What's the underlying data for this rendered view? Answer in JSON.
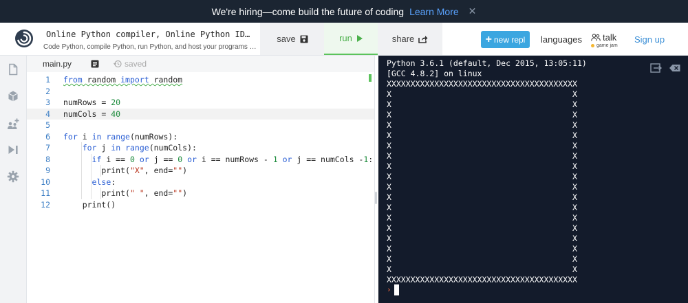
{
  "banner": {
    "text": "We're hiring—come build the future of coding",
    "link": "Learn More",
    "close": "✕"
  },
  "header": {
    "title": "Online Python compiler, Online Python ID…",
    "subtitle": "Code Python, compile Python, run Python, and host your programs …",
    "save_label": "save",
    "run_label": "run",
    "share_label": "share",
    "new_repl_label": "new repl",
    "languages_label": "languages",
    "talk_label": "talk",
    "talk_sub": "game jam",
    "signup_label": "Sign up"
  },
  "editor": {
    "tab": "main.py",
    "saved_label": "saved",
    "lines": [
      {
        "n": "1",
        "html": "<span class=\"squig\"><span class=\"kw\">from</span> random <span class=\"kw\">import</span> random</span>"
      },
      {
        "n": "2",
        "html": ""
      },
      {
        "n": "3",
        "html": "numRows = <span class=\"num\">20</span>"
      },
      {
        "n": "4",
        "html": "numCols = <span class=\"num\">40</span>"
      },
      {
        "n": "5",
        "html": ""
      },
      {
        "n": "6",
        "html": "<span class=\"kw\">for</span> i <span class=\"kw\">in</span> <span class=\"kw\">range</span>(numRows):"
      },
      {
        "n": "7",
        "html": "    <span class=\"kw\">for</span> j <span class=\"kw\">in</span> <span class=\"kw\">range</span>(numCols):"
      },
      {
        "n": "8",
        "html": "      <span class=\"kw\">if</span> i == <span class=\"num\">0</span> <span class=\"kw\">or</span> j == <span class=\"num\">0</span> <span class=\"kw\">or</span> i == numRows - <span class=\"num\">1</span> <span class=\"kw\">or</span> j == numCols -<span class=\"num\">1</span>:"
      },
      {
        "n": "9",
        "html": "        print(<span class=\"str\">\"X\"</span>, end=<span class=\"str\">\"\"</span>)"
      },
      {
        "n": "10",
        "html": "      <span class=\"kw\">else</span>:"
      },
      {
        "n": "11",
        "html": "        print(<span class=\"str\">\" \"</span>, end=<span class=\"str\">\"\"</span>)"
      },
      {
        "n": "12",
        "html": "    print()"
      }
    ]
  },
  "console": {
    "lines": [
      "Python 3.6.1 (default, Dec 2015, 13:05:11)",
      "[GCC 4.8.2] on linux",
      "XXXXXXXXXXXXXXXXXXXXXXXXXXXXXXXXXXXXXXXX",
      "X                                      X",
      "X                                      X",
      "X                                      X",
      "X                                      X",
      "X                                      X",
      "X                                      X",
      "X                                      X",
      "X                                      X",
      "X                                      X",
      "X                                      X",
      "X                                      X",
      "X                                      X",
      "X                                      X",
      "X                                      X",
      "X                                      X",
      "X                                      X",
      "X                                      X",
      "X                                      X",
      "XXXXXXXXXXXXXXXXXXXXXXXXXXXXXXXXXXXXXXXX"
    ],
    "prompt": "›"
  },
  "colors": {
    "banner_bg": "#1b2532",
    "console_bg": "#131b2b",
    "run_green": "#4bb04b",
    "accent_blue": "#3ba6e0"
  }
}
